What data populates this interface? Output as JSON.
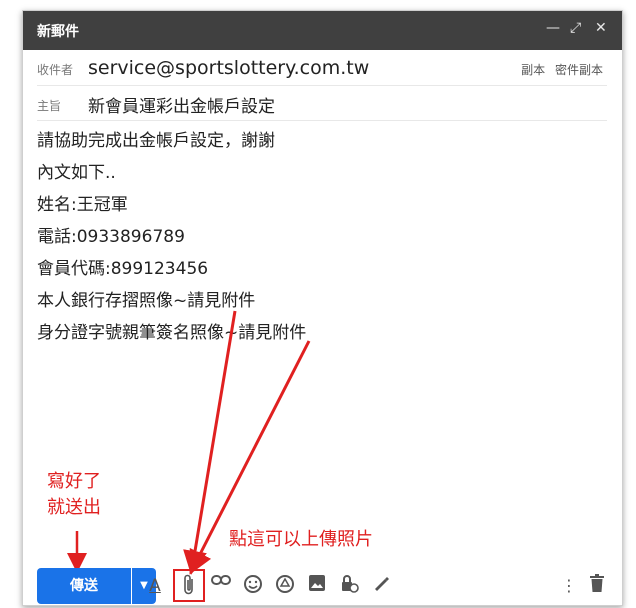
{
  "window": {
    "title": "新郵件",
    "minimize_icon": "minimize-icon",
    "expand_icon": "expand-icon",
    "close_icon": "close-icon"
  },
  "to": {
    "label": "收件者",
    "value": "service@sportslottery.com.tw",
    "cc": "副本",
    "bcc": "密件副本"
  },
  "subject": {
    "label": "主旨",
    "value": "新會員運彩出金帳戶設定"
  },
  "body": [
    "請協助完成出金帳戶設定，謝謝",
    "內文如下..",
    "姓名:王冠軍",
    "電話:0933896789",
    "會員代碼:899123456",
    "本人銀行存摺照像~請見附件",
    "身分證字號親筆簽名照像~請見附件"
  ],
  "annotations": {
    "send_note": [
      "寫好了",
      "就送出"
    ],
    "attach_note": "點這可以上傳照片",
    "color": "#e02020"
  },
  "toolbar": {
    "send_label": "傳送",
    "send_color": "#1a73e8",
    "icons": [
      "formatting-icon",
      "attach-icon",
      "link-icon",
      "emoji-icon",
      "drive-icon",
      "photo-icon",
      "confidential-icon",
      "signature-icon",
      "more-options-icon",
      "trash-icon"
    ]
  }
}
